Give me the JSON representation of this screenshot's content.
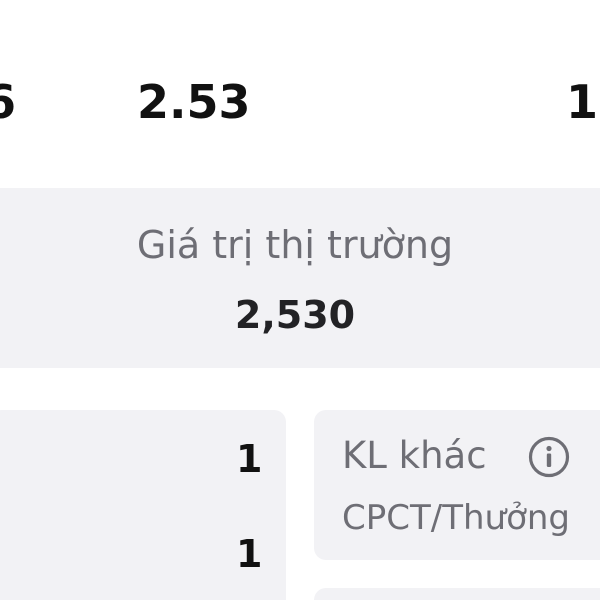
{
  "top_row": {
    "left_value": "6",
    "middle_value": "2.53",
    "right_value": "1"
  },
  "market": {
    "label": "Giá trị thị trường",
    "value": "2,530"
  },
  "left_card": {
    "values": [
      "1",
      "1"
    ]
  },
  "right_card": {
    "label": "KL khác",
    "sublabel": "CPCT/Thưởng",
    "icon": "info-icon"
  },
  "colors": {
    "card_background": "#f2f2f5",
    "label_gray": "#6e6e75",
    "value_dark": "#111111"
  }
}
